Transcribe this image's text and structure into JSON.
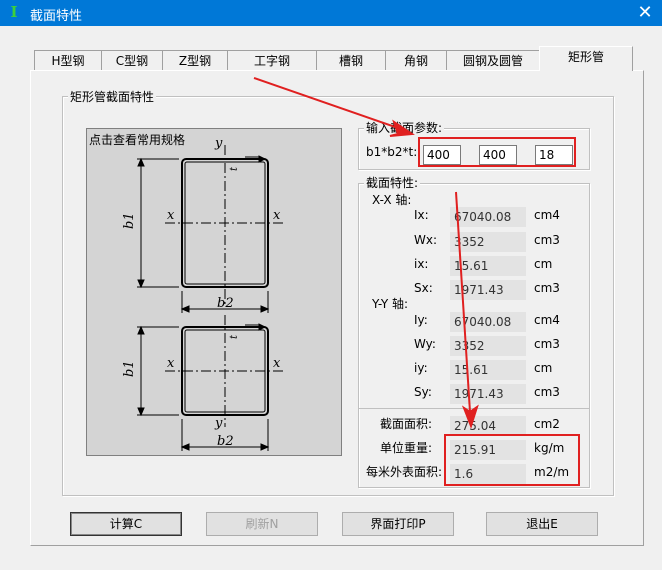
{
  "window": {
    "title": "截面特性",
    "close_glyph": "✕"
  },
  "tabs": [
    {
      "label": "H型钢"
    },
    {
      "label": "C型钢"
    },
    {
      "label": "Z型钢"
    },
    {
      "label": "工字钢"
    },
    {
      "label": "槽钢"
    },
    {
      "label": "角钢"
    },
    {
      "label": "圆钢及圆管"
    },
    {
      "label": "矩形管"
    }
  ],
  "active_tab": "矩形管",
  "main_group": {
    "title": "矩形管截面特性"
  },
  "figure": {
    "hint": "点击查看常用规格",
    "axis_y": "y",
    "axis_x": "x",
    "dim_b1": "b1",
    "dim_b2": "b2",
    "dim_t": "t"
  },
  "input_group": {
    "title": "输入截面参数:",
    "label": "b1*b2*t:",
    "b1": "400",
    "b2": "400",
    "t": "18"
  },
  "props_group": {
    "title": "截面特性:",
    "xx_axis": "X-X 轴:",
    "yy_axis": "Y-Y 轴:",
    "xx": [
      {
        "label": "Ix:",
        "value": "67040.08",
        "unit": "cm4"
      },
      {
        "label": "Wx:",
        "value": "3352",
        "unit": "cm3"
      },
      {
        "label": "ix:",
        "value": "15.61",
        "unit": "cm"
      },
      {
        "label": "Sx:",
        "value": "1971.43",
        "unit": "cm3"
      }
    ],
    "yy": [
      {
        "label": "Iy:",
        "value": "67040.08",
        "unit": "cm4"
      },
      {
        "label": "Wy:",
        "value": "3352",
        "unit": "cm3"
      },
      {
        "label": "iy:",
        "value": "15.61",
        "unit": "cm"
      },
      {
        "label": "Sy:",
        "value": "1971.43",
        "unit": "cm3"
      }
    ],
    "area": {
      "label": "截面面积:",
      "value": "275.04",
      "unit": "cm2"
    },
    "weight": {
      "label": "单位重量:",
      "value": "215.91",
      "unit": "kg/m"
    },
    "surface": {
      "label": "每米外表面积:",
      "value": "1.6",
      "unit": "m2/m"
    }
  },
  "buttons": {
    "calc": "计算C",
    "refresh": "刷新N",
    "print": "界面打印P",
    "exit": "退出E"
  },
  "colors": {
    "annotation": "#e02020",
    "titlebar": "#0078d7"
  }
}
